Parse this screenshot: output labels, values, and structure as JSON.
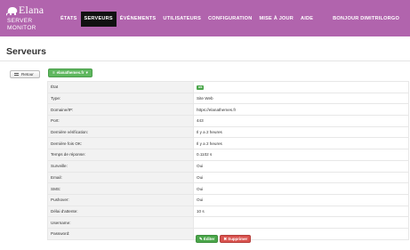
{
  "brand": {
    "name": "Elana",
    "sub1": "SERVER",
    "sub2": "MONITOR",
    "color": "#b164ad"
  },
  "nav": {
    "items": [
      {
        "label": "ÉTATS"
      },
      {
        "label": "SERVEURS"
      },
      {
        "label": "ÉVÉNEMENTS"
      },
      {
        "label": "UTILISATEURS"
      },
      {
        "label": "CONFIGURATION"
      },
      {
        "label": "MISE À JOUR"
      },
      {
        "label": "AIDE"
      }
    ],
    "active": "SERVEURS",
    "user": "BONJOUR DIMITRILORGO"
  },
  "page": {
    "title": "Serveurs",
    "back_label": "Retour",
    "server_select": "elanathemes.fr"
  },
  "details": [
    {
      "key": "État",
      "value": "ok",
      "badge": true
    },
    {
      "key": "Type:",
      "value": "Site Web"
    },
    {
      "key": "Domaine/IP:",
      "value": "https://elanathemes.fr"
    },
    {
      "key": "Port:",
      "value": "443"
    },
    {
      "key": "Dernière vérification:",
      "value": "Il y a 2 heures"
    },
    {
      "key": "Dernière fois OK:",
      "value": "Il y a 2 heures"
    },
    {
      "key": "Temps de réponse:",
      "value": "0.1102 s"
    },
    {
      "key": "Surveille:",
      "value": "Oui"
    },
    {
      "key": "Email:",
      "value": "Oui"
    },
    {
      "key": "SMS:",
      "value": "Oui"
    },
    {
      "key": "Pushover:",
      "value": "Oui"
    },
    {
      "key": "Délai d'attente:",
      "value": "10 s"
    },
    {
      "key": "Username:",
      "value": ""
    },
    {
      "key": "Password:",
      "value": ""
    }
  ],
  "actions": {
    "edit_label": "Éditer",
    "delete_label": "Supprimer"
  },
  "colors": {
    "ok_badge": "#4aa64a",
    "edit": "#4aa64a",
    "delete": "#d9534f"
  }
}
